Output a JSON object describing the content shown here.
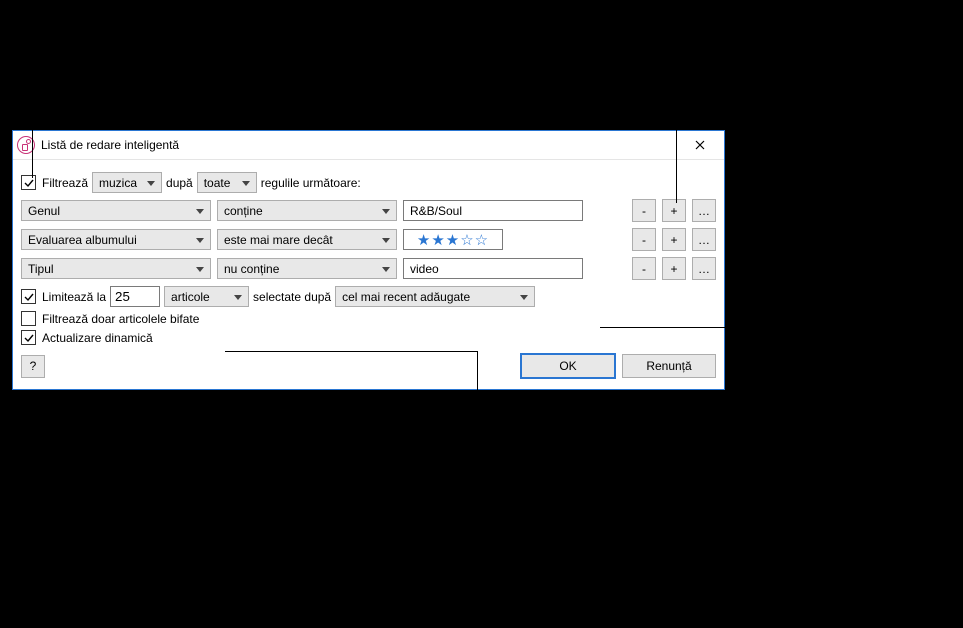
{
  "dialog": {
    "title": "Listă de redare inteligentă"
  },
  "filter": {
    "checkbox_label": "Filtrează",
    "source": "muzica",
    "after_label": "după",
    "match": "toate",
    "suffix": "regulile următoare:"
  },
  "rules": [
    {
      "field": "Genul",
      "op": "conține",
      "value": "R&B/Soul",
      "type": "text"
    },
    {
      "field": "Evaluarea albumului",
      "op": "este mai mare decât",
      "value": 3,
      "type": "rating",
      "max": 5
    },
    {
      "field": "Tipul",
      "op": "nu conține",
      "value": "video",
      "type": "text"
    }
  ],
  "rule_buttons": {
    "remove": "-",
    "add": "+",
    "more": "…"
  },
  "limit": {
    "checkbox_label": "Limitează la",
    "count": "25",
    "unit": "articole",
    "selected_label": "selectate după",
    "by": "cel mai recent adăugate"
  },
  "checked_only": {
    "label": "Filtrează doar articolele bifate",
    "checked": false
  },
  "live_update": {
    "label": "Actualizare dinamică",
    "checked": true
  },
  "buttons": {
    "help": "?",
    "ok": "OK",
    "cancel": "Renunță"
  }
}
